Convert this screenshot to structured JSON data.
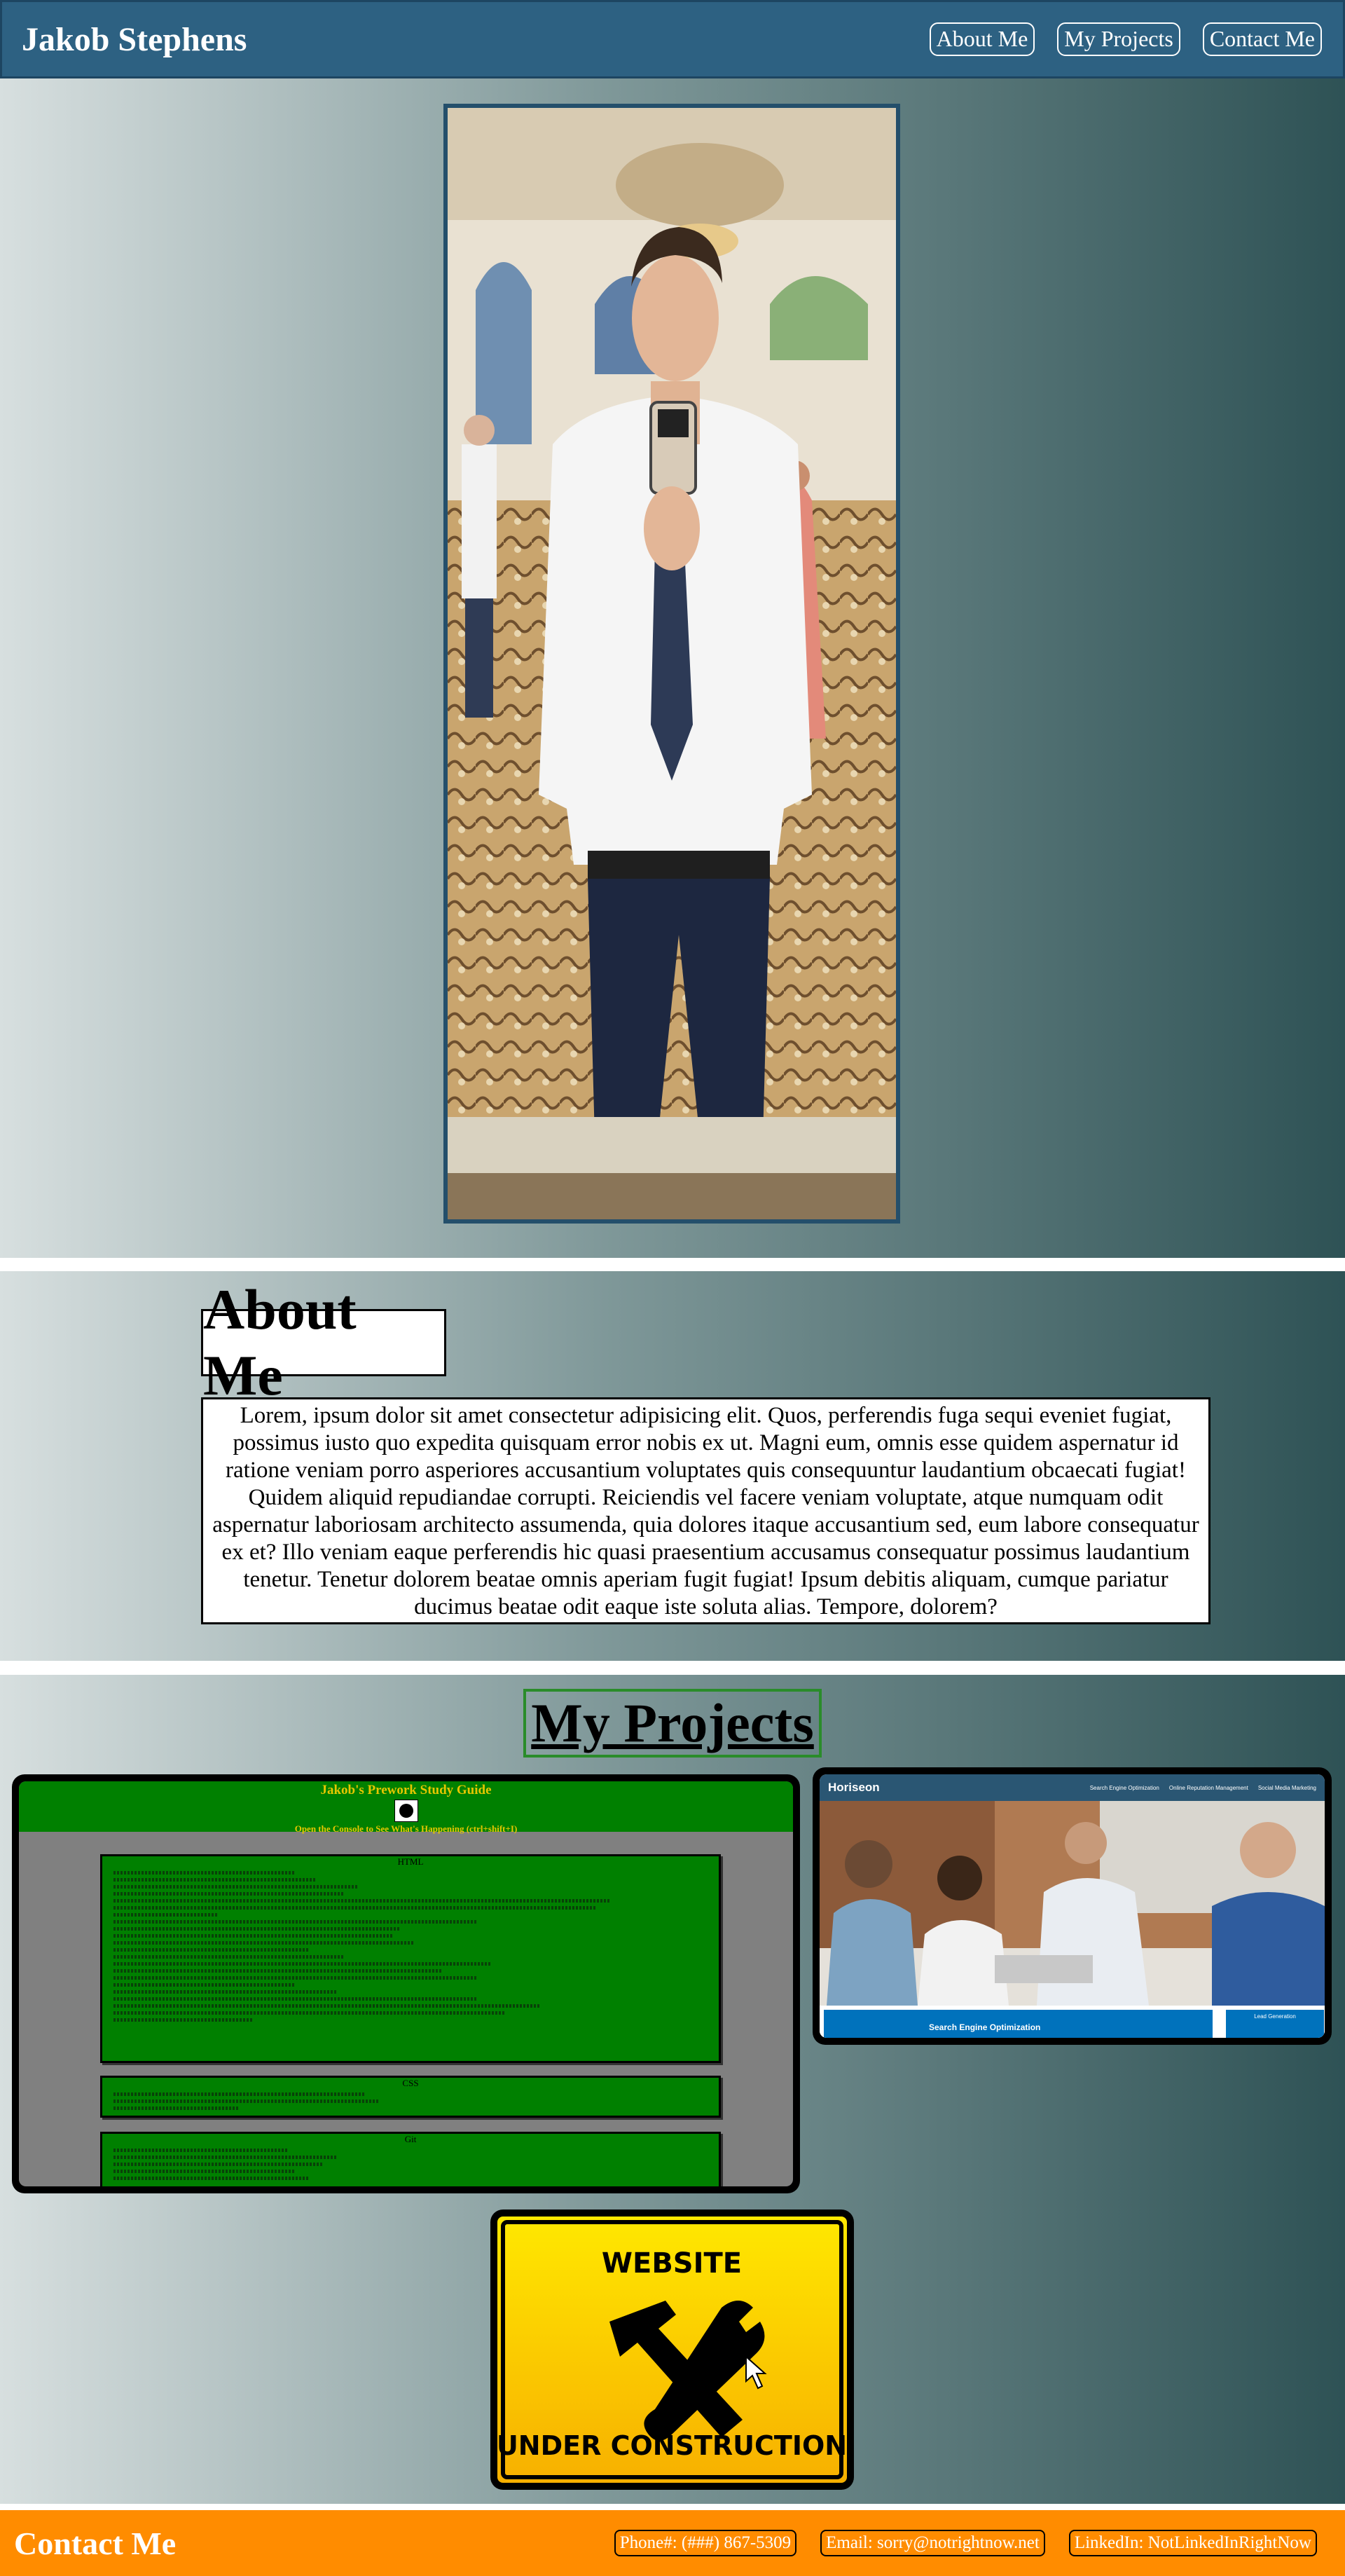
{
  "header": {
    "name": "Jakob Stephens",
    "nav": [
      {
        "label": "About Me"
      },
      {
        "label": "My Projects"
      },
      {
        "label": "Contact Me"
      }
    ]
  },
  "about": {
    "title": "About Me",
    "body": "Lorem, ipsum dolor sit amet consectetur adipisicing elit. Quos, perferendis fuga sequi eveniet fugiat, possimus iusto quo expedita quisquam error nobis ex ut. Magni eum, omnis esse quidem aspernatur id ratione veniam porro asperiores accusantium voluptates quis consequuntur laudantium obcaecati fugiat! Quidem aliquid repudiandae corrupti. Reiciendis vel facere veniam voluptate, atque numquam odit aspernatur laboriosam architecto assumenda, quia dolores itaque accusantium sed, eum labore consequatur ex et? Illo veniam eaque perferendis hic quasi praesentium accusamus consequatur possimus laudantium tenetur. Tenetur dolorem beatae omnis aperiam fugit fugiat! Ipsum debitis aliquam, cumque pariatur ducimus beatae odit eaque iste soluta alias. Tempore, dolorem?"
  },
  "projects": {
    "title": "My Projects",
    "study_guide": {
      "title": "Jakob's Prework Study Guide",
      "console": "Open the Console to See What's Happening (ctrl+shift+I)",
      "sections": [
        "HTML",
        "CSS",
        "Git"
      ]
    },
    "horiseon": {
      "logo": "Horiseon",
      "links": [
        "Search Engine Optimization",
        "Online Reputation Management",
        "Social Media Marketing"
      ],
      "banner": "Search Engine Optimization",
      "lead": "Lead Generation"
    },
    "construction": {
      "top": "WEBSITE",
      "bottom": "UNDER CONSTRUCTION"
    }
  },
  "contact": {
    "title": "Contact Me",
    "phone": "Phone#: (###) 867-5309",
    "email": "Email: sorry@notrightnow.net",
    "linkedin": "LinkedIn: NotLinkedInRightNow"
  },
  "colors": {
    "header": "#2d6182",
    "contact": "#ff8c00",
    "study_green": "#008000",
    "gradient_left": "#d7dfdf",
    "gradient_right": "#2e5255"
  },
  "icons": [
    "hammer-wrench-icon",
    "cursor-arrow-icon"
  ]
}
